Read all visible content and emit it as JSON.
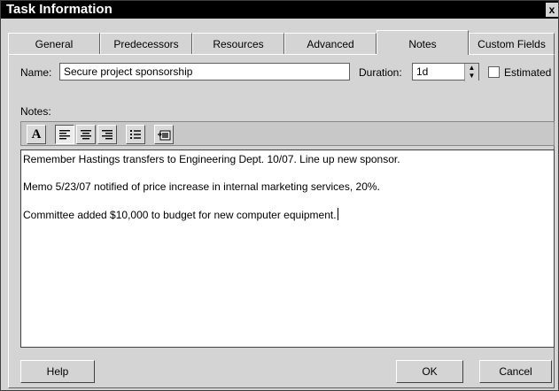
{
  "window": {
    "title": "Task Information",
    "close_glyph": "x"
  },
  "tabs": [
    {
      "label": "General"
    },
    {
      "label": "Predecessors"
    },
    {
      "label": "Resources"
    },
    {
      "label": "Advanced"
    },
    {
      "label": "Notes",
      "active": true
    },
    {
      "label": "Custom Fields"
    }
  ],
  "form": {
    "name_label": "Name:",
    "name_value": "Secure project sponsorship",
    "duration_label": "Duration:",
    "duration_value": "1d",
    "estimated_label": "Estimated",
    "estimated_checked": false
  },
  "notes": {
    "label": "Notes:",
    "toolbar": {
      "buttons": [
        {
          "icon": "font-icon",
          "glyph": "A"
        },
        {
          "icon": "align-left-icon",
          "pressed": true
        },
        {
          "icon": "align-center-icon"
        },
        {
          "icon": "align-right-icon"
        },
        {
          "icon": "bullet-list-icon"
        },
        {
          "icon": "insert-object-icon"
        }
      ]
    },
    "lines": [
      "Remember Hastings transfers to Engineering Dept. 10/07. Line up new sponsor.",
      "Memo 5/23/07 notified of price increase in internal marketing services, 20%.",
      "Committee added $10,000 to budget for new computer equipment."
    ]
  },
  "buttons": {
    "help": "Help",
    "ok": "OK",
    "cancel": "Cancel"
  }
}
